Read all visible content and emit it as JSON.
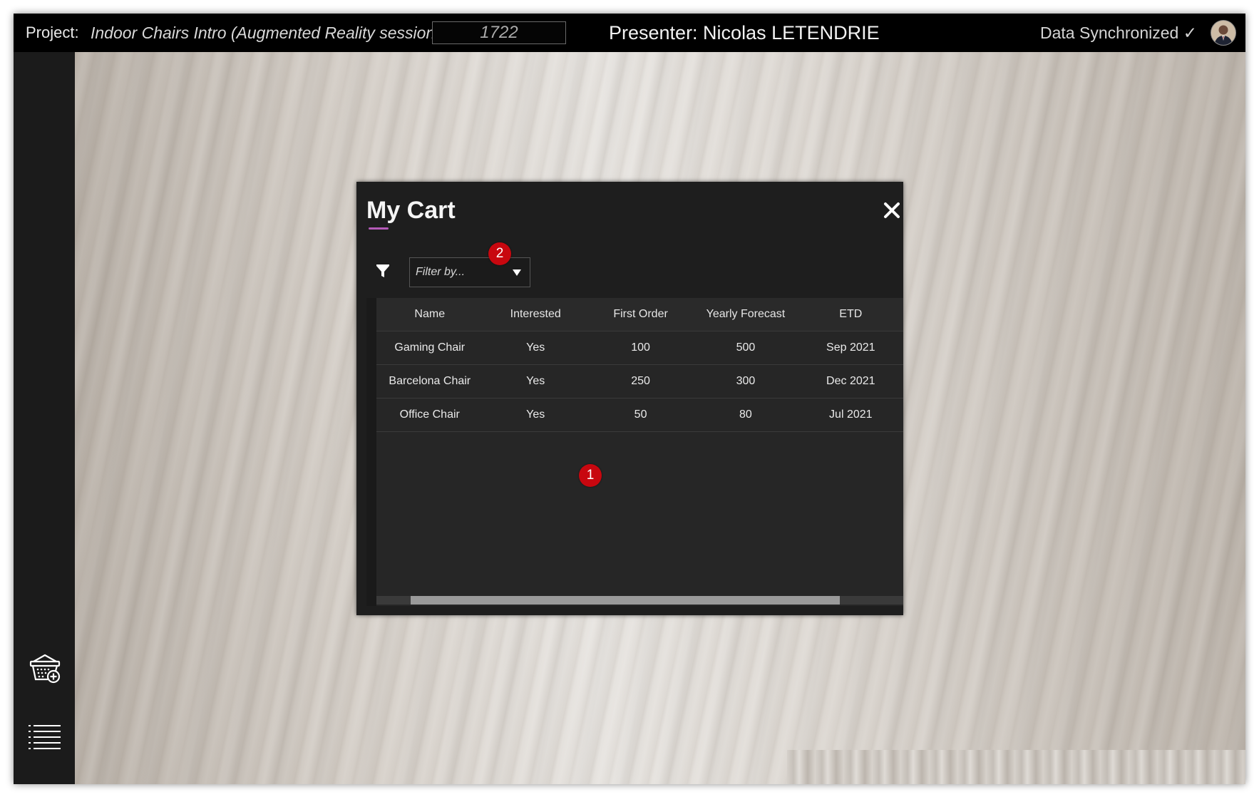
{
  "topbar": {
    "project_label": "Project:",
    "project_name": "Indoor Chairs Intro (Augmented Reality session)",
    "session_id": "1722",
    "presenter": "Presenter: Nicolas LETENDRIE",
    "sync_status": "Data Synchronized ✓"
  },
  "sidebar": {
    "items": [
      {
        "icon": "cart-add-icon"
      },
      {
        "icon": "list-menu-icon"
      }
    ]
  },
  "cart": {
    "title": "My Cart",
    "filter_placeholder": "Filter by...",
    "columns": [
      "Name",
      "Interested",
      "First Order",
      "Yearly Forecast",
      "ETD"
    ],
    "rows": [
      [
        "Gaming Chair",
        "Yes",
        "100",
        "500",
        "Sep 2021"
      ],
      [
        "Barcelona Chair",
        "Yes",
        "250",
        "300",
        "Dec 2021"
      ],
      [
        "Office Chair",
        "Yes",
        "50",
        "80",
        "Jul 2021"
      ]
    ]
  },
  "annotations": {
    "marker_1": "1",
    "marker_2": "2"
  },
  "colors": {
    "topbar": "#000000",
    "sidebar": "#1b1b1b",
    "modal": "#1e1e1e",
    "accent_underline": "#b45ab8",
    "marker": "#c8070f"
  }
}
